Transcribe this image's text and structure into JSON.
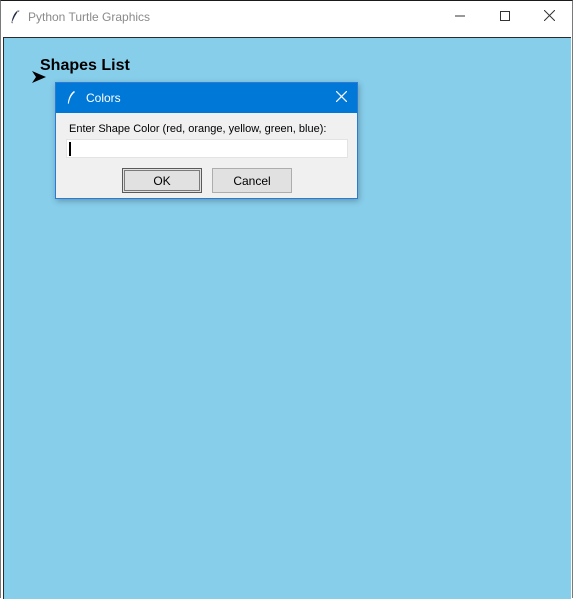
{
  "window": {
    "title": "Python Turtle Graphics",
    "app_icon": "feather-icon",
    "controls": {
      "minimize_icon": "minimize-icon",
      "maximize_icon": "maximize-icon",
      "close_icon": "close-icon"
    }
  },
  "canvas": {
    "background_color": "#87ceeb",
    "heading_text": "Shapes List",
    "turtle_icon": "turtle-arrow-icon"
  },
  "dialog": {
    "title": "Colors",
    "title_icon": "feather-icon",
    "title_bar_color": "#0078d7",
    "prompt": "Enter Shape Color (red, orange, yellow, green, blue):",
    "input_value": "",
    "ok_label": "OK",
    "cancel_label": "Cancel"
  }
}
